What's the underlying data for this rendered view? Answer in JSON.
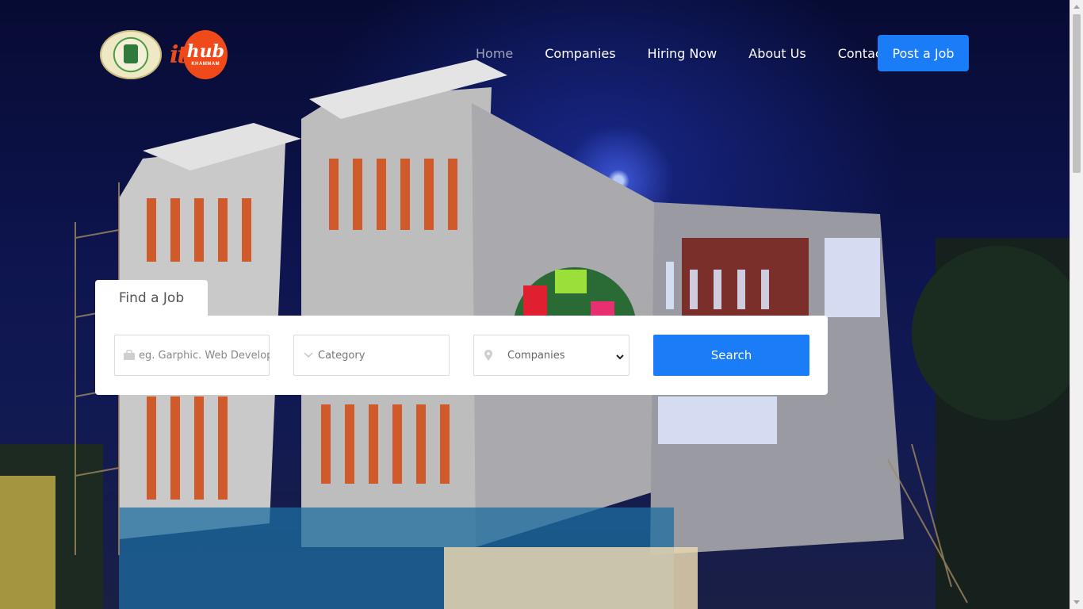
{
  "header": {
    "logo_primary": "Government of Telangana",
    "logo_it": "it",
    "logo_hub": "hub",
    "logo_city": "KHAMMAM"
  },
  "nav": {
    "items": [
      {
        "label": "Home",
        "active": true
      },
      {
        "label": "Companies",
        "active": false
      },
      {
        "label": "Hiring Now",
        "active": false
      },
      {
        "label": "About Us",
        "active": false
      },
      {
        "label": "Contact",
        "active": false
      }
    ],
    "cta_label": "Post a Job"
  },
  "search": {
    "tab_label": "Find a Job",
    "keyword_placeholder": "eg. Garphic. Web Developer",
    "category_label": "Category",
    "companies_selected": "Companies",
    "button_label": "Search"
  },
  "colors": {
    "accent": "#1a7cf6",
    "brand_orange": "#f04a1b",
    "nav_active": "#a0a4b8"
  },
  "icons": [
    "briefcase-icon",
    "chevron-down-icon",
    "map-pin-icon",
    "select-caret-icon"
  ]
}
